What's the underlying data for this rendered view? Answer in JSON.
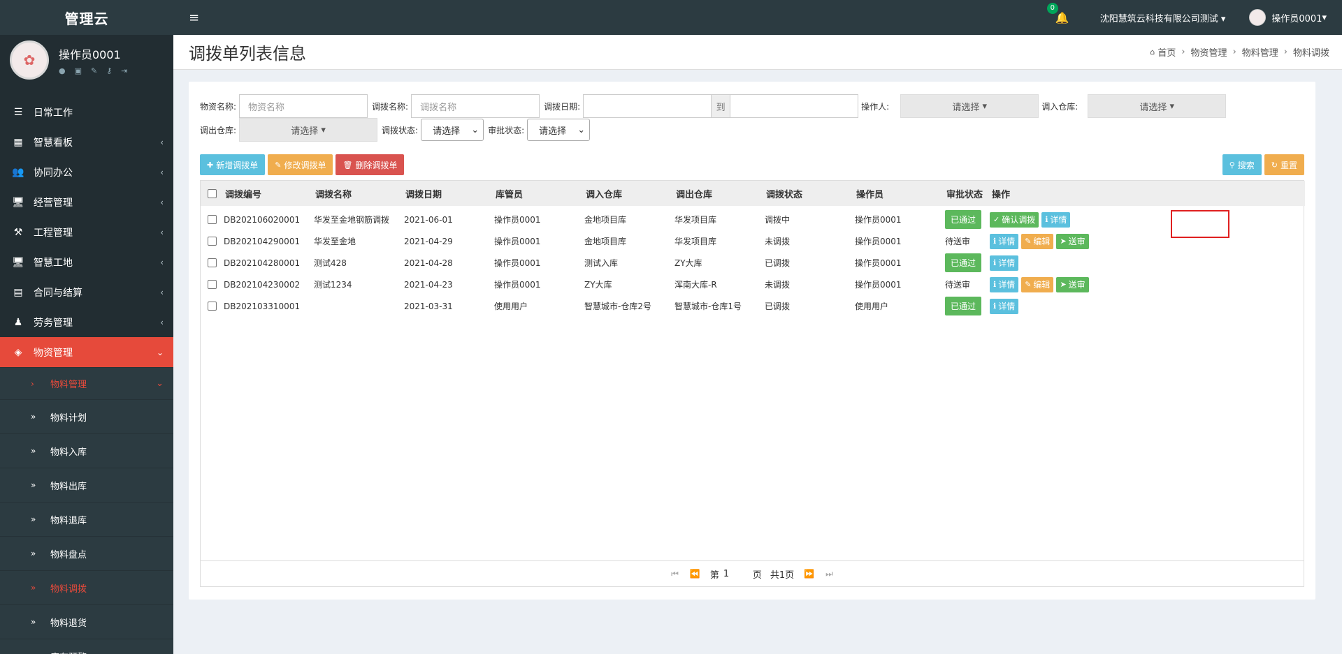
{
  "app": {
    "logo": "管理云"
  },
  "user": {
    "name": "操作员0001"
  },
  "header": {
    "notif_count": "0",
    "company": "沈阳慧筑云科技有限公司测试",
    "user": "操作员0001"
  },
  "menu": [
    {
      "label": "日常工作",
      "icon": "list-icon",
      "glyph": "☰"
    },
    {
      "label": "智慧看板",
      "icon": "dashboard-icon",
      "glyph": "▦"
    },
    {
      "label": "协同办公",
      "icon": "users-icon",
      "glyph": "👥"
    },
    {
      "label": "经营管理",
      "icon": "desktop-icon",
      "glyph": "🖥"
    },
    {
      "label": "工程管理",
      "icon": "gavel-icon",
      "glyph": "⚒"
    },
    {
      "label": "智慧工地",
      "icon": "desktop-icon",
      "glyph": "🖥"
    },
    {
      "label": "合同与结算",
      "icon": "file-icon",
      "glyph": "▤"
    },
    {
      "label": "劳务管理",
      "icon": "worker-icon",
      "glyph": "♟"
    },
    {
      "label": "物资管理",
      "icon": "cube-icon",
      "glyph": "◈"
    }
  ],
  "submenu": {
    "group": "物料管理",
    "items": [
      "物料计划",
      "物料入库",
      "物料出库",
      "物料退库",
      "物料盘点",
      "物料调拨",
      "物料退货",
      "库存预警"
    ]
  },
  "page": {
    "title": "调拨单列表信息",
    "breadcrumb": [
      "首页",
      "物资管理",
      "物料管理",
      "物料调拨"
    ]
  },
  "filters": {
    "material_name_label": "物资名称:",
    "material_name_placeholder": "物资名称",
    "transfer_name_label": "调拨名称:",
    "transfer_name_placeholder": "调拨名称",
    "date_label": "调拨日期:",
    "date_to": "到",
    "operator_label": "操作人:",
    "select_placeholder": "请选择",
    "in_wh_label": "调入仓库:",
    "out_wh_label": "调出仓库:",
    "transfer_status_label": "调拨状态:",
    "approval_status_label": "审批状态:"
  },
  "toolbar": {
    "add": "新增调拨单",
    "edit": "修改调拨单",
    "delete": "删除调拨单",
    "search": "搜索",
    "reset": "重置"
  },
  "table": {
    "columns": [
      "调拨编号",
      "调拨名称",
      "调拨日期",
      "库管员",
      "调入仓库",
      "调出仓库",
      "调拨状态",
      "操作员",
      "审批状态",
      "操作"
    ],
    "rows": [
      {
        "code": "DB202106020001",
        "name": "华发至金地钢筋调拨",
        "date": "2021-06-01",
        "keeper": "操作员0001",
        "in_wh": "金地项目库",
        "out_wh": "华发项目库",
        "status": "调拨中",
        "operator": "操作员0001",
        "approval": "已通过",
        "actions": [
          "确认调拨",
          "详情"
        ]
      },
      {
        "code": "DB202104290001",
        "name": "华发至金地",
        "date": "2021-04-29",
        "keeper": "操作员0001",
        "in_wh": "金地项目库",
        "out_wh": "华发项目库",
        "status": "未调拨",
        "operator": "操作员0001",
        "approval": "待送审",
        "actions": [
          "详情",
          "编辑",
          "送审"
        ]
      },
      {
        "code": "DB202104280001",
        "name": "测试428",
        "date": "2021-04-28",
        "keeper": "操作员0001",
        "in_wh": "测试入库",
        "out_wh": "ZY大库",
        "status": "已调拨",
        "operator": "操作员0001",
        "approval": "已通过",
        "actions": [
          "详情"
        ]
      },
      {
        "code": "DB202104230002",
        "name": "测试1234",
        "date": "2021-04-23",
        "keeper": "操作员0001",
        "in_wh": "ZY大库",
        "out_wh": "浑南大库-R",
        "status": "未调拨",
        "operator": "操作员0001",
        "approval": "待送审",
        "actions": [
          "详情",
          "编辑",
          "送审"
        ]
      },
      {
        "code": "DB202103310001",
        "name": "",
        "date": "2021-03-31",
        "keeper": "使用用户",
        "in_wh": "智慧城市-仓库2号",
        "out_wh": "智慧城市-仓库1号",
        "status": "已调拨",
        "operator": "使用用户",
        "approval": "已通过",
        "actions": [
          "详情"
        ]
      }
    ]
  },
  "pager": {
    "page_prefix": "第",
    "page": "1",
    "page_suffix": "页",
    "total": "共1页"
  },
  "colors": {
    "sidebar": "#222d32",
    "header": "#2c3b41",
    "active": "#e64a3b",
    "info": "#5bc0de",
    "warning": "#f0ad4e",
    "danger": "#d9534f",
    "success": "#5cb85c"
  }
}
